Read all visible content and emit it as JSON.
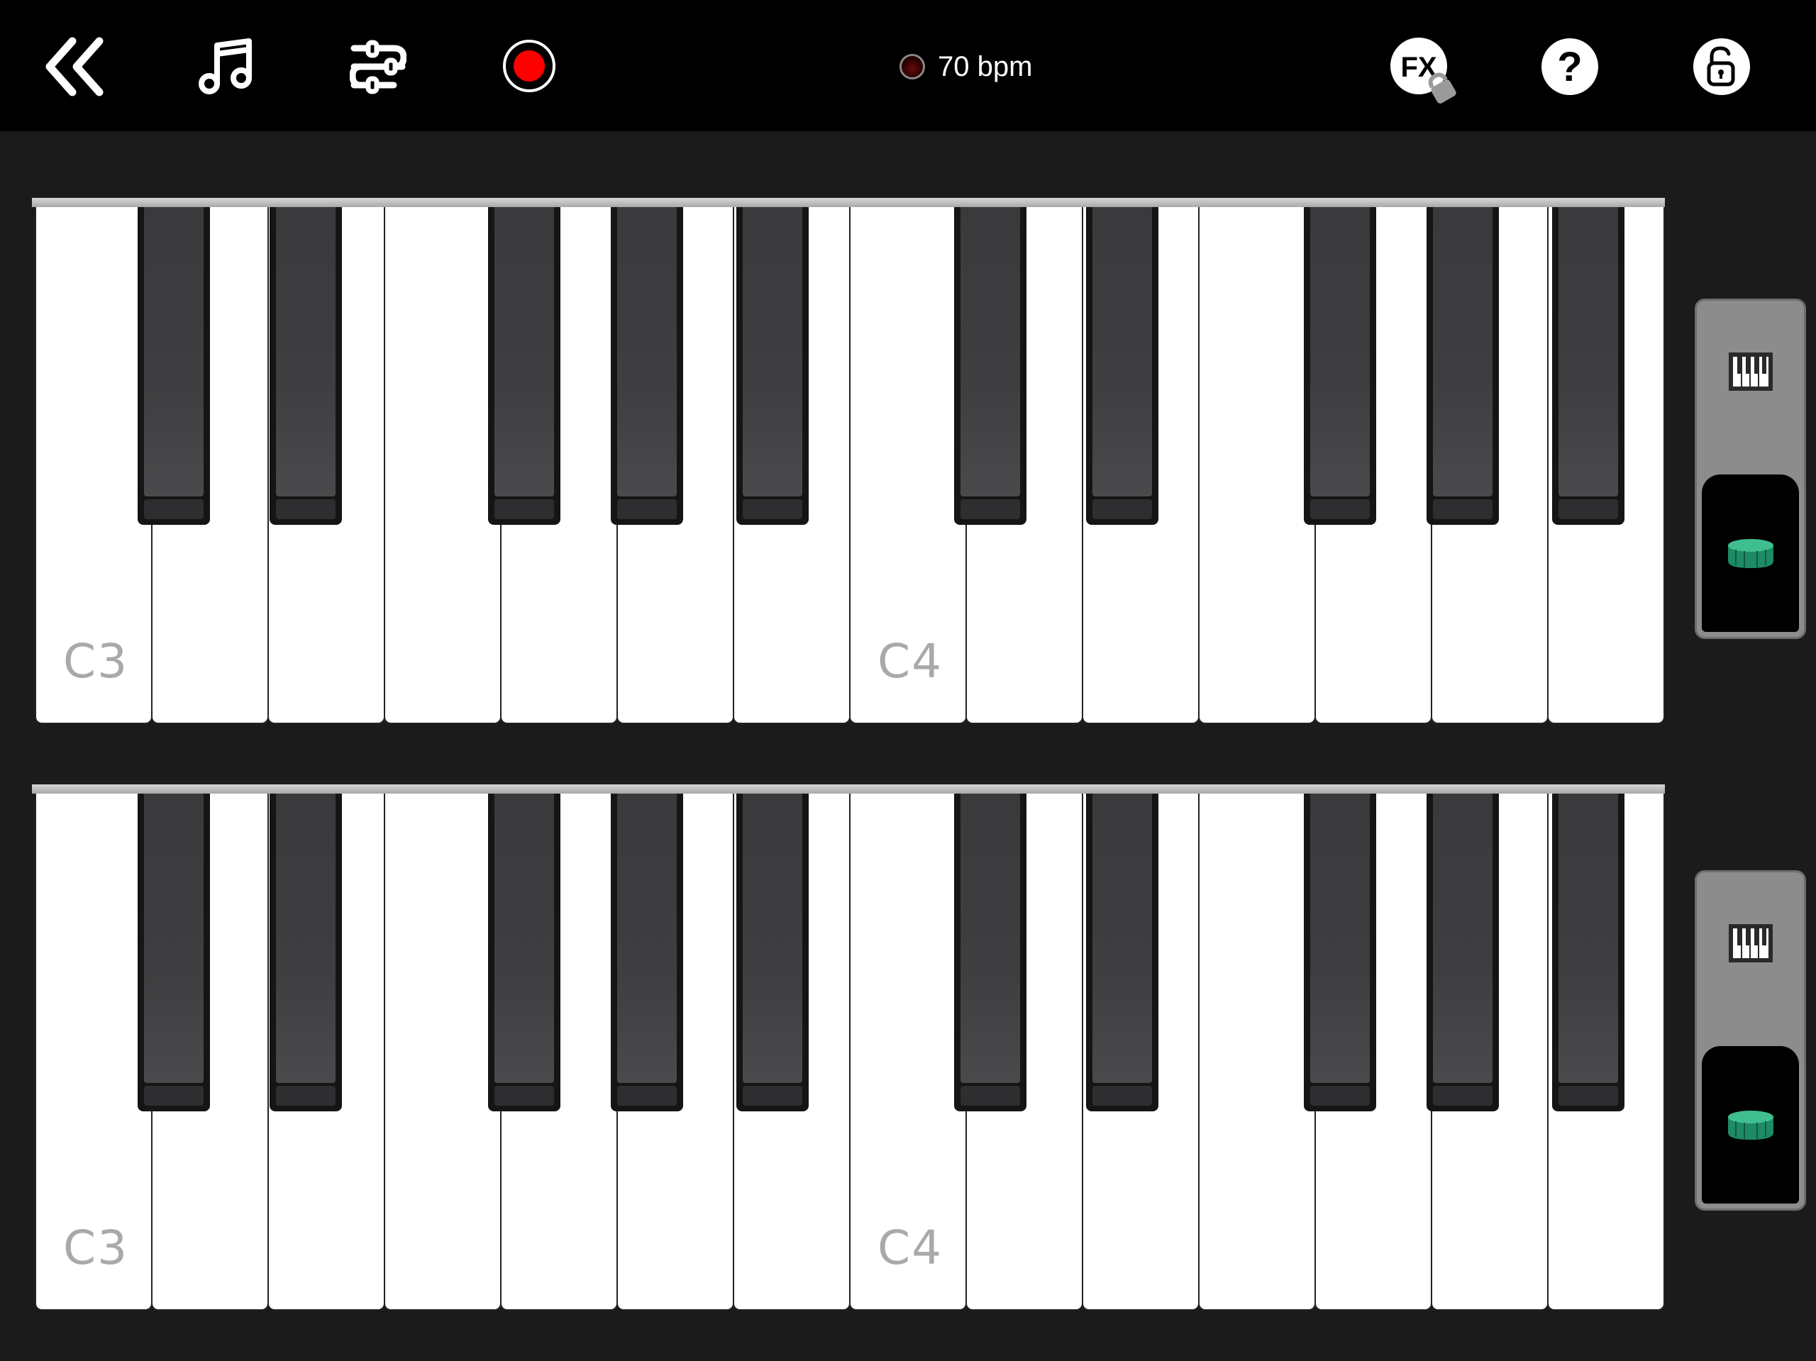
{
  "toolbar": {
    "buttons": [
      {
        "name": "back-button",
        "icon": "double-chevron-left-icon"
      },
      {
        "name": "songs-button",
        "icon": "music-note-icon"
      },
      {
        "name": "settings-button",
        "icon": "sliders-icon"
      },
      {
        "name": "record-button",
        "icon": "record-icon"
      },
      {
        "name": "fx-button",
        "icon": "fx-locked-icon",
        "label": "FX"
      },
      {
        "name": "help-button",
        "icon": "question-icon",
        "label": "?"
      },
      {
        "name": "lock-button",
        "icon": "unlock-icon"
      }
    ],
    "metronome": {
      "value": "70 bpm",
      "indicator_color": "#5a0505"
    }
  },
  "keyboards": [
    {
      "id": "upper",
      "labels": {
        "c3": "C3",
        "c4": "C4"
      },
      "mode_switcher": {
        "options": [
          "piano-icon",
          "drum-icon"
        ],
        "selected": "drum-icon"
      }
    },
    {
      "id": "lower",
      "labels": {
        "c3": "C3",
        "c4": "C4"
      },
      "mode_switcher": {
        "options": [
          "piano-icon",
          "drum-icon"
        ],
        "selected": "drum-icon"
      }
    }
  ],
  "keys": {
    "white": [
      "C3",
      "D3",
      "E3",
      "F3",
      "G3",
      "A3",
      "B3",
      "C4",
      "D4",
      "E4",
      "F4",
      "G4",
      "A4",
      "B4"
    ],
    "black": [
      "C#3",
      "D#3",
      "F#3",
      "G#3",
      "A#3",
      "C#4",
      "D#4",
      "F#4",
      "G#4",
      "A#4"
    ]
  },
  "colors": {
    "record": "#ff0000",
    "drum": "#1e8a66",
    "background": "#1b1b1b",
    "toolbar": "#000000"
  }
}
